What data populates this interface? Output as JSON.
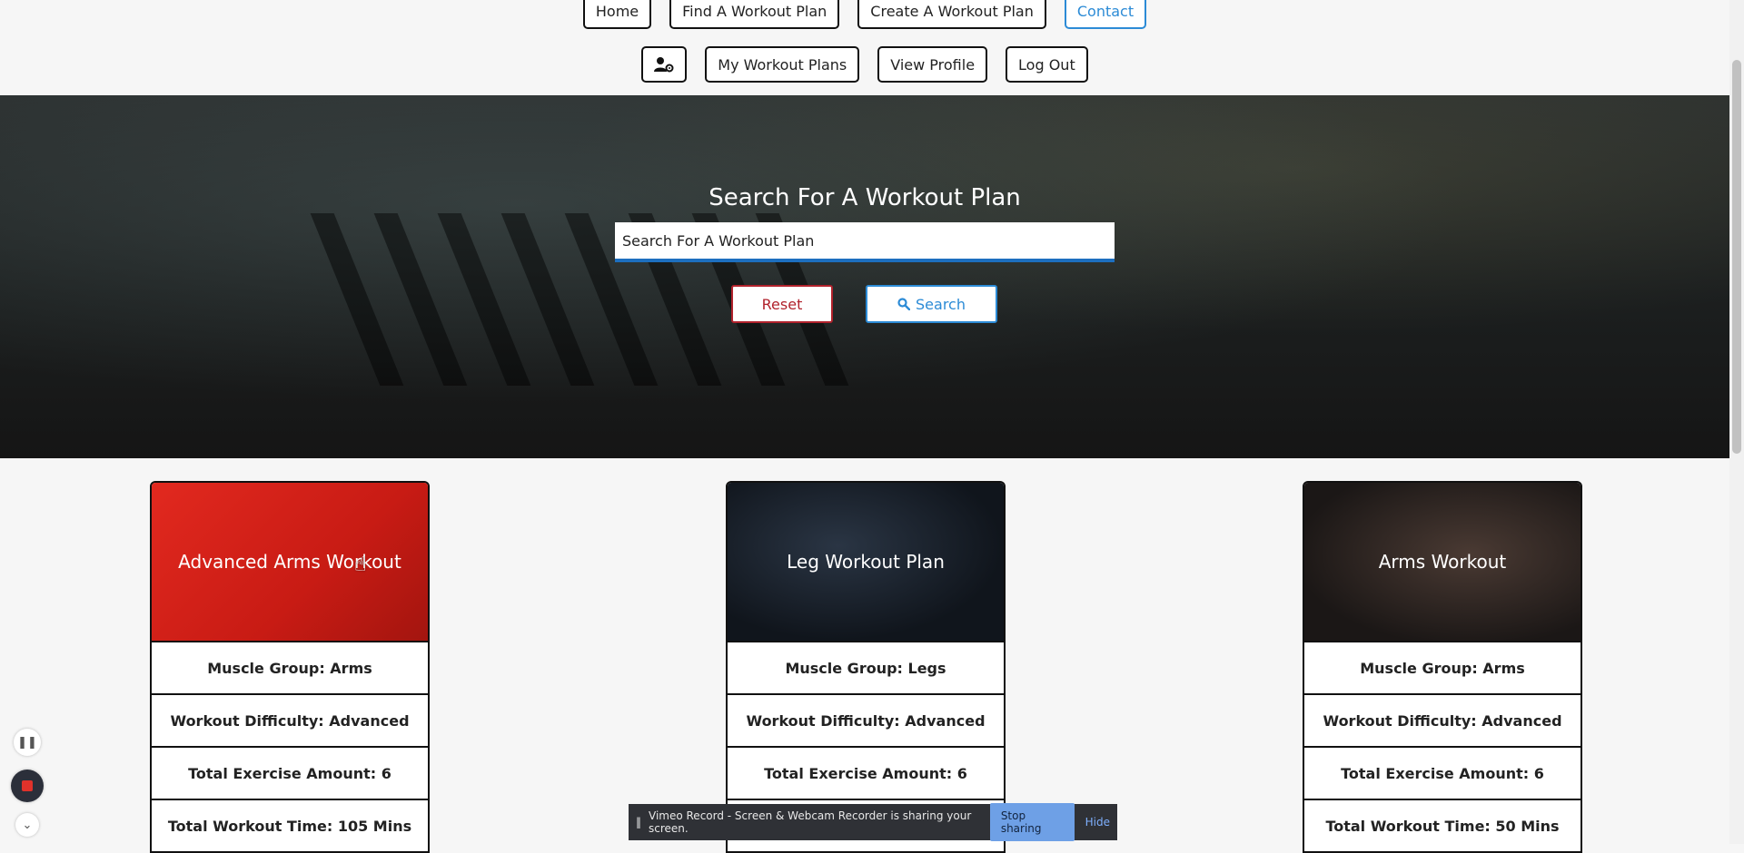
{
  "nav": {
    "row1": [
      "Home",
      "Find A Workout Plan",
      "Create A Workout Plan",
      "Contact"
    ],
    "row2": [
      "My Workout Plans",
      "View Profile",
      "Log Out"
    ],
    "settings_icon": "user-gear-icon"
  },
  "hero": {
    "title": "Search For A Workout Plan",
    "search_placeholder": "Search For A Workout Plan",
    "reset_label": "Reset",
    "search_label": "Search",
    "search_icon": "magnifier-icon"
  },
  "cards": [
    {
      "title": "Advanced Arms Workout",
      "muscle": "Muscle Group: Arms",
      "difficulty": "Workout Difficulty: Advanced",
      "exercises": "Total Exercise Amount: 6",
      "time": "Total Workout Time: 105 Mins"
    },
    {
      "title": "Leg Workout Plan",
      "muscle": "Muscle Group: Legs",
      "difficulty": "Workout Difficulty: Advanced",
      "exercises": "Total Exercise Amount: 6",
      "time": ""
    },
    {
      "title": "Arms Workout",
      "muscle": "Muscle Group: Arms",
      "difficulty": "Workout Difficulty: Advanced",
      "exercises": "Total Exercise Amount: 6",
      "time": "Total Workout Time: 50 Mins"
    }
  ],
  "recorder": {
    "message": "Vimeo Record - Screen & Webcam Recorder is sharing your screen.",
    "stop_label": "Stop sharing",
    "hide_label": "Hide"
  },
  "colors": {
    "accent": "#2c8bd6",
    "danger": "#b1222c",
    "card_highlight": "#e2291f"
  }
}
